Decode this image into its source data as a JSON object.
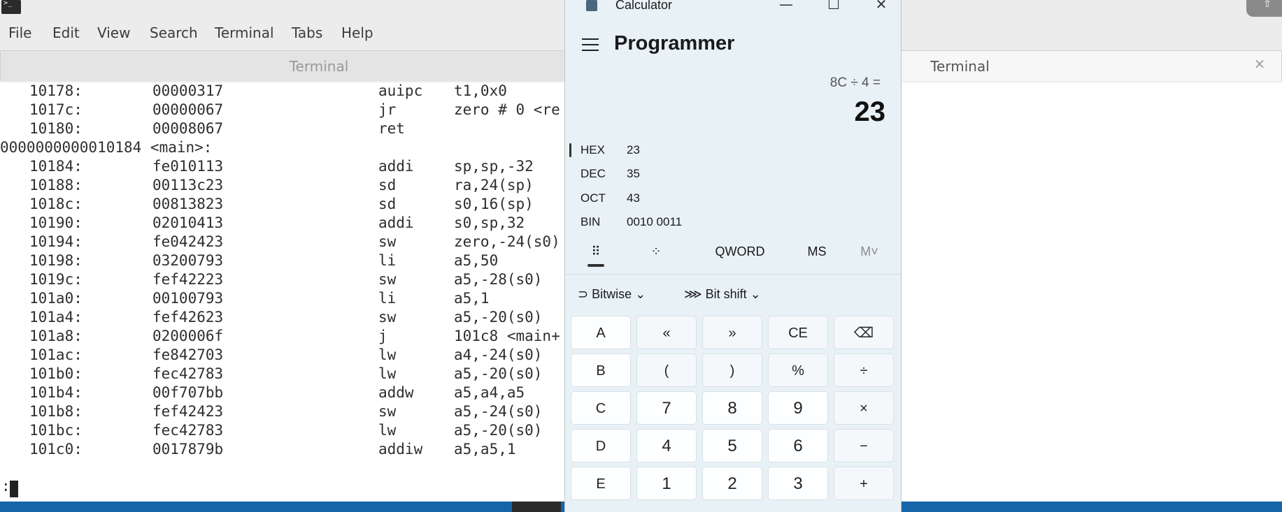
{
  "terminal": {
    "menu": [
      "File",
      "Edit",
      "View",
      "Search",
      "Terminal",
      "Tabs",
      "Help"
    ],
    "tabs": [
      "Terminal",
      "Terminal"
    ],
    "tab_close": "×",
    "lines": [
      {
        "addr": "10178:",
        "hex": "00000317",
        "op": "auipc",
        "arg": "t1,0x0"
      },
      {
        "addr": "1017c:",
        "hex": "00000067",
        "op": "jr",
        "arg": "zero # 0 <re"
      },
      {
        "addr": "10180:",
        "hex": "00008067",
        "op": "ret",
        "arg": ""
      },
      {
        "header": "0000000000010184 <main>:"
      },
      {
        "addr": "10184:",
        "hex": "fe010113",
        "op": "addi",
        "arg": "sp,sp,-32"
      },
      {
        "addr": "10188:",
        "hex": "00113c23",
        "op": "sd",
        "arg": "ra,24(sp)"
      },
      {
        "addr": "1018c:",
        "hex": "00813823",
        "op": "sd",
        "arg": "s0,16(sp)"
      },
      {
        "addr": "10190:",
        "hex": "02010413",
        "op": "addi",
        "arg": "s0,sp,32"
      },
      {
        "addr": "10194:",
        "hex": "fe042423",
        "op": "sw",
        "arg": "zero,-24(s0)"
      },
      {
        "addr": "10198:",
        "hex": "03200793",
        "op": "li",
        "arg": "a5,50"
      },
      {
        "addr": "1019c:",
        "hex": "fef42223",
        "op": "sw",
        "arg": "a5,-28(s0)"
      },
      {
        "addr": "101a0:",
        "hex": "00100793",
        "op": "li",
        "arg": "a5,1"
      },
      {
        "addr": "101a4:",
        "hex": "fef42623",
        "op": "sw",
        "arg": "a5,-20(s0)"
      },
      {
        "addr": "101a8:",
        "hex": "0200006f",
        "op": "j",
        "arg": "101c8 <main+"
      },
      {
        "addr": "101ac:",
        "hex": "fe842703",
        "op": "lw",
        "arg": "a4,-24(s0)"
      },
      {
        "addr": "101b0:",
        "hex": "fec42783",
        "op": "lw",
        "arg": "a5,-20(s0)"
      },
      {
        "addr": "101b4:",
        "hex": "00f707bb",
        "op": "addw",
        "arg": "a5,a4,a5"
      },
      {
        "addr": "101b8:",
        "hex": "fef42423",
        "op": "sw",
        "arg": "a5,-24(s0)"
      },
      {
        "addr": "101bc:",
        "hex": "fec42783",
        "op": "lw",
        "arg": "a5,-20(s0)"
      },
      {
        "addr": "101c0:",
        "hex": "0017879b",
        "op": "addiw",
        "arg": "a5,a5,1"
      }
    ],
    "prompt": ":"
  },
  "calculator": {
    "title": "Calculator",
    "mode": "Programmer",
    "expression": "8C ÷ 4 =",
    "result": "23",
    "radix": [
      {
        "label": "HEX",
        "value": "23"
      },
      {
        "label": "DEC",
        "value": "35"
      },
      {
        "label": "OCT",
        "value": "43"
      },
      {
        "label": "BIN",
        "value": "0010 0011"
      }
    ],
    "word_size": "QWORD",
    "memory_store": "MS",
    "memory_recall": "M˅",
    "bitwise": "Bitwise",
    "bitshift": "Bit shift",
    "keys": [
      [
        "A",
        "«",
        "»",
        "CE",
        "⌫"
      ],
      [
        "B",
        "(",
        ")",
        "%",
        "÷"
      ],
      [
        "C",
        "7",
        "8",
        "9",
        "×"
      ],
      [
        "D",
        "4",
        "5",
        "6",
        "−"
      ],
      [
        "E",
        "1",
        "2",
        "3",
        "+"
      ]
    ]
  }
}
